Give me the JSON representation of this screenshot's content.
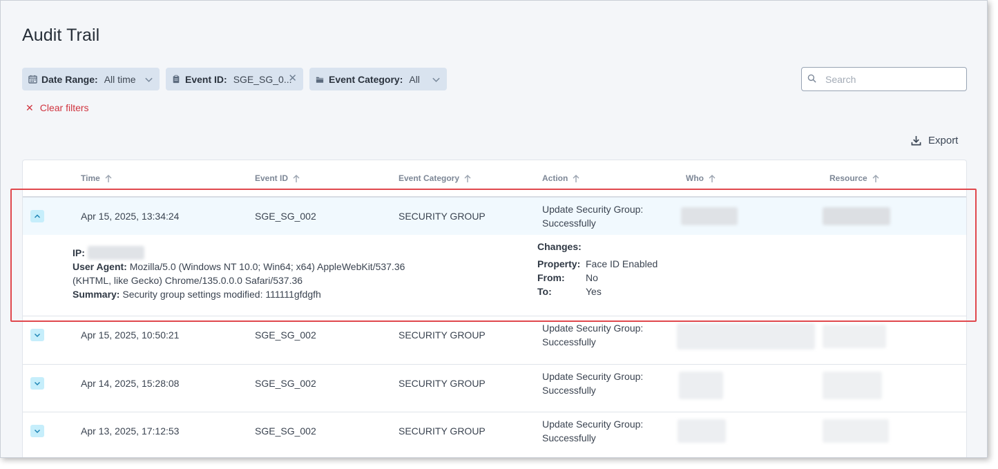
{
  "page": {
    "title": "Audit Trail"
  },
  "filters": {
    "date_range": {
      "label": "Date Range:",
      "value": "All time",
      "icon": "calendar-icon"
    },
    "event_id": {
      "label": "Event ID:",
      "value": "SGE_SG_0...",
      "icon": "clipboard-icon"
    },
    "event_category": {
      "label": "Event Category:",
      "value": "All",
      "icon": "folder-icon"
    },
    "clear_label": "Clear filters"
  },
  "search": {
    "placeholder": "Search",
    "value": ""
  },
  "toolbar": {
    "export_label": "Export"
  },
  "table": {
    "columns": [
      "Time",
      "Event ID",
      "Event Category",
      "Action",
      "Who",
      "Resource"
    ],
    "rows": [
      {
        "time": "Apr 15, 2025, 13:34:24",
        "event_id": "SGE_SG_002",
        "category": "SECURITY GROUP",
        "action_line1": "Update Security Group:",
        "action_line2": "Successfully",
        "expanded": true
      },
      {
        "time": "Apr 15, 2025, 10:50:21",
        "event_id": "SGE_SG_002",
        "category": "SECURITY GROUP",
        "action_line1": "Update Security Group:",
        "action_line2": "Successfully",
        "expanded": false
      },
      {
        "time": "Apr 14, 2025, 15:28:08",
        "event_id": "SGE_SG_002",
        "category": "SECURITY GROUP",
        "action_line1": "Update Security Group:",
        "action_line2": "Successfully",
        "expanded": false
      },
      {
        "time": "Apr 13, 2025, 17:12:53",
        "event_id": "SGE_SG_002",
        "category": "SECURITY GROUP",
        "action_line1": "Update Security Group:",
        "action_line2": "Successfully",
        "expanded": false
      }
    ]
  },
  "detail": {
    "ip_label": "IP:",
    "user_agent_label": "User Agent:",
    "user_agent_line1": "Mozilla/5.0 (Windows NT 10.0; Win64; x64) AppleWebKit/537.36",
    "user_agent_line2": "(KHTML, like Gecko) Chrome/135.0.0.0 Safari/537.36",
    "summary_label": "Summary:",
    "summary_value": "Security group settings modified: 111111gfdgfh",
    "changes_label": "Changes:",
    "property_label": "Property:",
    "property_value": "Face ID Enabled",
    "from_label": "From:",
    "from_value": "No",
    "to_label": "To:",
    "to_value": "Yes"
  },
  "colors": {
    "accent": "#1e85b5",
    "danger": "#d0343f",
    "highlight": "#e0474c",
    "chip_bg": "#d9e3ef"
  }
}
